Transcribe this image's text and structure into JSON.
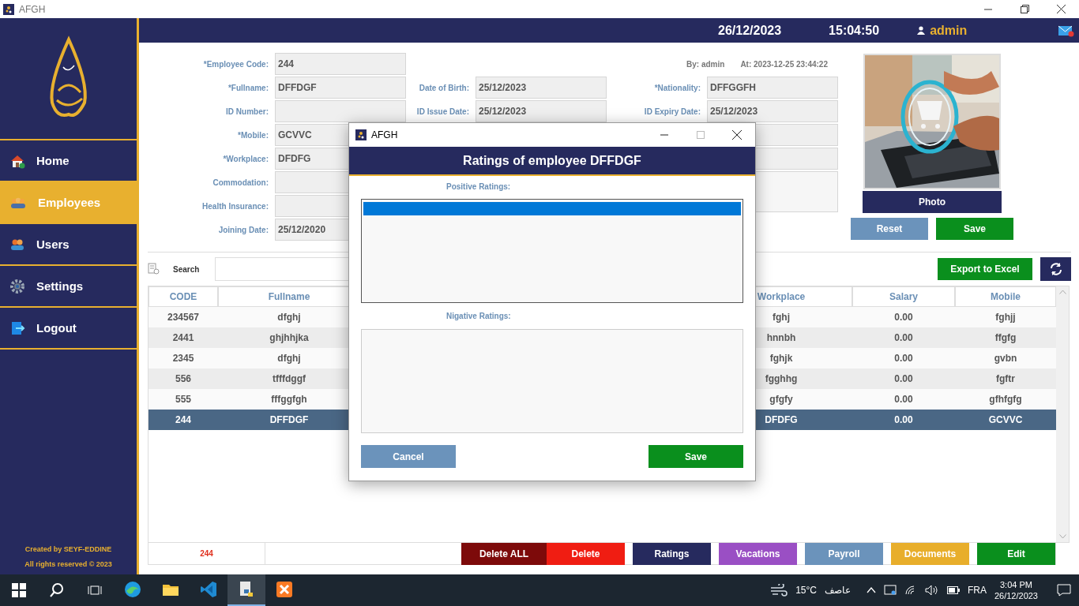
{
  "window": {
    "title": "AFGH"
  },
  "header": {
    "date": "26/12/2023",
    "time": "15:04:50",
    "user": "admin"
  },
  "sidebar": {
    "items": [
      {
        "label": "Home",
        "kind": "home",
        "selected": false
      },
      {
        "label": "Employees",
        "kind": "employees",
        "selected": true
      },
      {
        "label": "Users",
        "kind": "users",
        "selected": false
      },
      {
        "label": "Settings",
        "kind": "settings",
        "selected": false
      },
      {
        "label": "Logout",
        "kind": "logout",
        "selected": false
      }
    ],
    "footer": [
      "Created by SEYF-EDDINE",
      "All rights reserved © 2023"
    ]
  },
  "form": {
    "meta": [
      "By: admin",
      "At: 2023-12-25 23:44:22"
    ],
    "left": [
      {
        "label": "*Employee Code:",
        "value": "244"
      },
      {
        "label": "*Fullname:",
        "value": "DFFDGF"
      },
      {
        "label": "ID Number:"
      },
      {
        "label": "*Mobile:",
        "value": "GCVVC"
      },
      {
        "label": "*Workplace:",
        "value": "DFDFG"
      },
      {
        "label": "Commodation:"
      },
      {
        "label": "Health Insurance:"
      },
      {
        "label": "Joining Date:",
        "value": "25/12/2020"
      }
    ],
    "middle": [
      {
        "label": "Date of Birth:",
        "value": "25/12/2023"
      },
      {
        "label": "ID Issue Date:",
        "value": "25/12/2023"
      }
    ],
    "right": [
      {
        "kind": "field",
        "label": "*Nationality:",
        "value": "DFFGGFH"
      },
      {
        "kind": "field",
        "label": "ID Expiry Date:",
        "value": "25/12/2023"
      },
      {
        "kind": "field"
      },
      {
        "kind": "field"
      },
      {
        "kind": "area"
      }
    ]
  },
  "photo": {
    "kind": "picture",
    "button": "Photo"
  },
  "form_buttons": [
    {
      "label": "Reset",
      "color": "#6b93bb"
    },
    {
      "label": "Save",
      "color": "#0a8f1d"
    }
  ],
  "search": {
    "label": "Search"
  },
  "export_button": "Export to Excel",
  "table": {
    "columns": [
      "CODE",
      "Fullname",
      "Workplace",
      "Salary",
      "Mobile"
    ],
    "rows": [
      {
        "cells": [
          "234567",
          "dfghj",
          "fghj",
          "0.00",
          "fghjj"
        ],
        "selected": false
      },
      {
        "cells": [
          "2441",
          "ghjhhjka",
          "hnnbh",
          "0.00",
          "ffgfg"
        ],
        "selected": false
      },
      {
        "cells": [
          "2345",
          "dfghj",
          "fghjk",
          "0.00",
          "gvbn"
        ],
        "selected": false
      },
      {
        "cells": [
          "556",
          "tfffdggf",
          "fgghhg",
          "0.00",
          "fgftr"
        ],
        "selected": false
      },
      {
        "cells": [
          "555",
          "fffggfgh",
          "gfgfy",
          "0.00",
          "gfhfgfg"
        ],
        "selected": false
      },
      {
        "cells": [
          "244",
          "DFFDGF",
          "DFDFG",
          "0.00",
          "GCVVC"
        ],
        "selected": true
      }
    ]
  },
  "bottom_bar": {
    "counter": "244",
    "buttons": [
      {
        "label": "Delete ALL",
        "color": "#7d0a0a"
      },
      {
        "label": "Delete",
        "color": "#f01d12"
      },
      {
        "label": "Ratings",
        "color": "#262a5e"
      },
      {
        "label": "Vacations",
        "color": "#9a4fc4"
      },
      {
        "label": "Payroll",
        "color": "#6b93bb"
      },
      {
        "label": "Documents",
        "color": "#e8ae2b"
      },
      {
        "label": "Edit",
        "color": "#0a8f1d"
      }
    ]
  },
  "dialog": {
    "title": "AFGH",
    "heading": "Ratings of employee DFFDGF",
    "positive": {
      "label": "Positive Ratings:",
      "items": [
        {
          "selected": true
        }
      ]
    },
    "negative": {
      "label": "Nigative Ratings:"
    },
    "buttons": [
      {
        "label": "Cancel",
        "color": "#6b93bb"
      },
      {
        "label": "Save",
        "color": "#0a8f1d"
      }
    ]
  },
  "taskbar": {
    "apps": [
      {
        "kind": "edge",
        "selected": false
      },
      {
        "kind": "explorer",
        "selected": false
      },
      {
        "kind": "vscode",
        "selected": false
      },
      {
        "kind": "python",
        "selected": true
      },
      {
        "kind": "xampp",
        "selected": false
      }
    ],
    "temperature": "15°C",
    "weather": "عاصف",
    "language": "FRA",
    "time": "3:04 PM",
    "date": "26/12/2023"
  }
}
